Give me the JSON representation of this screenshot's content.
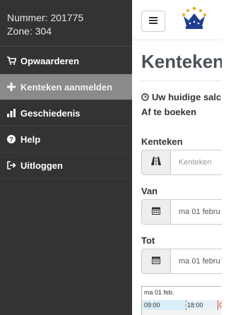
{
  "account": {
    "nummer": "Nummer: 201775",
    "zone": "Zone: 304"
  },
  "nav": {
    "items": [
      {
        "label": "Opwaarderen",
        "icon": "cart-icon",
        "active": false
      },
      {
        "label": "Kenteken aanmelden",
        "icon": "plus-icon",
        "active": true
      },
      {
        "label": "Geschiedenis",
        "icon": "bar-chart-icon",
        "active": false
      },
      {
        "label": "Help",
        "icon": "question-circle-icon",
        "active": false
      },
      {
        "label": "Uitloggen",
        "icon": "logout-icon",
        "active": false
      }
    ]
  },
  "header": {
    "menu_icon": "hamburger-icon",
    "logo": "crown-logo"
  },
  "main": {
    "title": "Kenteken",
    "saldo": "Uw huidige salc",
    "afteboeken": "Af te boeken",
    "kenteken_label": "Kenteken",
    "kenteken_placeholder": "Kenteken",
    "van_label": "Van",
    "van_value": "ma 01 febru",
    "tot_label": "Tot",
    "tot_value": "ma 01 febru"
  },
  "timeline": {
    "date": "ma 01 feb.",
    "start": "09:00",
    "end": "18:00",
    "cut": "C"
  },
  "colors": {
    "sidebar": "#333333",
    "active": "#8a8a8a",
    "title": "#4b5057"
  }
}
